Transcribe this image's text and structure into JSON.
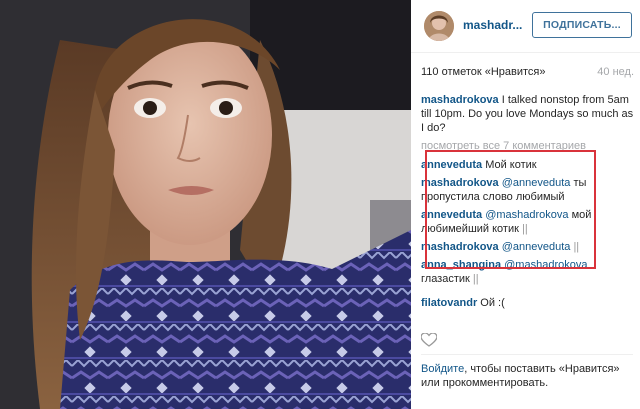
{
  "post": {
    "username": "mashadr...",
    "follow_label": "ПОДПИСАТЬ...",
    "likes": "110 отметок «Нравится»",
    "time_ago": "40 нед."
  },
  "caption": {
    "author": "mashadrokova",
    "text": "I talked nonstop from 5am till 10pm. Do you love Mondays so much as I do?"
  },
  "view_all_label": "посмотреть все 7 комментариев",
  "comments": [
    {
      "author": "anneveduta",
      "mention": "",
      "text": "Мой котик",
      "cursor": ""
    },
    {
      "author": "mashadrokova",
      "mention": "@anneveduta",
      "text": "ты пропустила слово любимый",
      "cursor": ""
    },
    {
      "author": "anneveduta",
      "mention": "@mashadrokova",
      "text": "мой любимейший котик",
      "cursor": "||"
    },
    {
      "author": "mashadrokova",
      "mention": "@anneveduta",
      "text": "",
      "cursor": "||"
    },
    {
      "author": "anna_shangina",
      "mention": "@mashadrokova",
      "text": "глазастик",
      "cursor": "||"
    },
    {
      "author": "filatovandr",
      "mention": "",
      "text": "Ой :(",
      "cursor": ""
    }
  ],
  "login": {
    "link": "Войдите",
    "text": ", чтобы поставить «Нравится» или прокомментировать."
  },
  "colors": {
    "link": "#125688",
    "follow": "#3f729b",
    "highlight": "#d9333b"
  }
}
